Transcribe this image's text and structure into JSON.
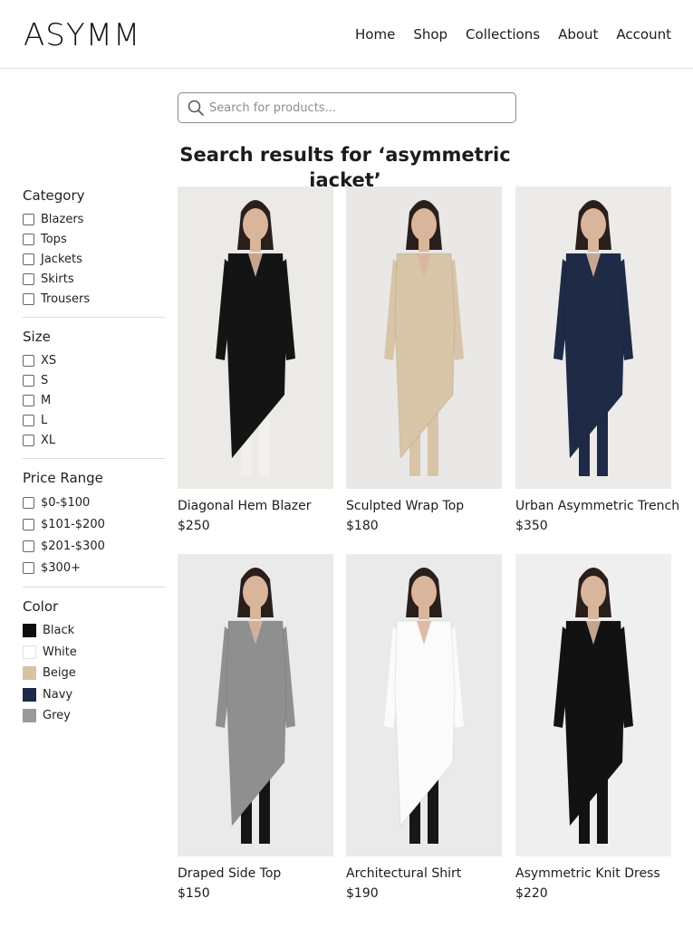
{
  "brand": {
    "logo": "ASYMM"
  },
  "nav": [
    "Home",
    "Shop",
    "Collections",
    "About",
    "Account"
  ],
  "search": {
    "placeholder": "Search for products...",
    "value": ""
  },
  "results": {
    "title": "Search results for ‘asymmetric jacket’"
  },
  "filters": {
    "category": {
      "heading": "Category",
      "options": [
        "Blazers",
        "Tops",
        "Jackets",
        "Skirts",
        "Trousers"
      ]
    },
    "size": {
      "heading": "Size",
      "options": [
        "XS",
        "S",
        "M",
        "L",
        "XL"
      ]
    },
    "price": {
      "heading": "Price Range",
      "options": [
        "$0-$100",
        "$101-$200",
        "$201-$300",
        "$300+"
      ]
    },
    "color": {
      "heading": "Color",
      "options": [
        {
          "label": "Black",
          "hex": "#0e0e0e"
        },
        {
          "label": "White",
          "hex": "#ffffff"
        },
        {
          "label": "Beige",
          "hex": "#d9c2a3"
        },
        {
          "label": "Navy",
          "hex": "#1e2a4a"
        },
        {
          "label": "Grey",
          "hex": "#9a9a9a"
        }
      ]
    }
  },
  "products": [
    {
      "name": "Diagonal Hem Blazer",
      "price": "$250",
      "garment": "#141414",
      "under": "#f2f0ec",
      "bg": "#eceae7"
    },
    {
      "name": "Sculpted Wrap Top",
      "price": "$180",
      "garment": "#d8c4a6",
      "under": "#d8c4a6",
      "bg": "#e9e8e6"
    },
    {
      "name": "Urban Asymmetric Trench",
      "price": "$350",
      "garment": "#1f2a47",
      "under": "#1f2a47",
      "bg": "#ecebea"
    },
    {
      "name": "Draped Side Top",
      "price": "$150",
      "garment": "#8f8f8f",
      "under": "#151515",
      "bg": "#eaeaea"
    },
    {
      "name": "Architectural Shirt",
      "price": "$190",
      "garment": "#fbfbfb",
      "under": "#171717",
      "bg": "#eaeaea"
    },
    {
      "name": "Asymmetric Knit Dress",
      "price": "$220",
      "garment": "#121212",
      "under": "#121212",
      "bg": "#efefef"
    }
  ]
}
